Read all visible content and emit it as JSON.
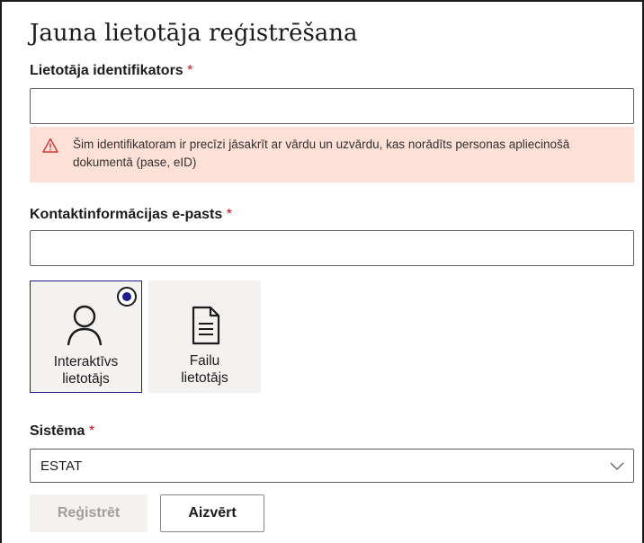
{
  "form": {
    "title": "Jauna lietotāja reģistrēšana",
    "user_id": {
      "label": "Lietotāja identifikators",
      "required_mark": "*",
      "value": "",
      "warning": "Šim identifikatoram ir precīzi jāsakrīt ar vārdu un uzvārdu, kas norādīts personas apliecinošā dokumentā (pase, eID)",
      "warning_icon": "warning-triangle-icon"
    },
    "email": {
      "label": "Kontaktinformācijas e-pasts",
      "required_mark": "*",
      "value": ""
    },
    "user_type": {
      "options": [
        {
          "line1": "Interaktīvs",
          "line2": "lietotājs",
          "icon": "person-icon",
          "selected": true
        },
        {
          "line1": "Failu",
          "line2": "lietotājs",
          "icon": "document-icon",
          "selected": false
        }
      ]
    },
    "system": {
      "label": "Sistēma",
      "required_mark": "*",
      "value": "ESTAT"
    },
    "buttons": {
      "register": "Reģistrēt",
      "close": "Aizvērt"
    }
  },
  "colors": {
    "accent": "#1f1e8c",
    "required": "#c50f1f",
    "warning_bg": "#fde0d6",
    "warning_icon": "#d13438"
  }
}
